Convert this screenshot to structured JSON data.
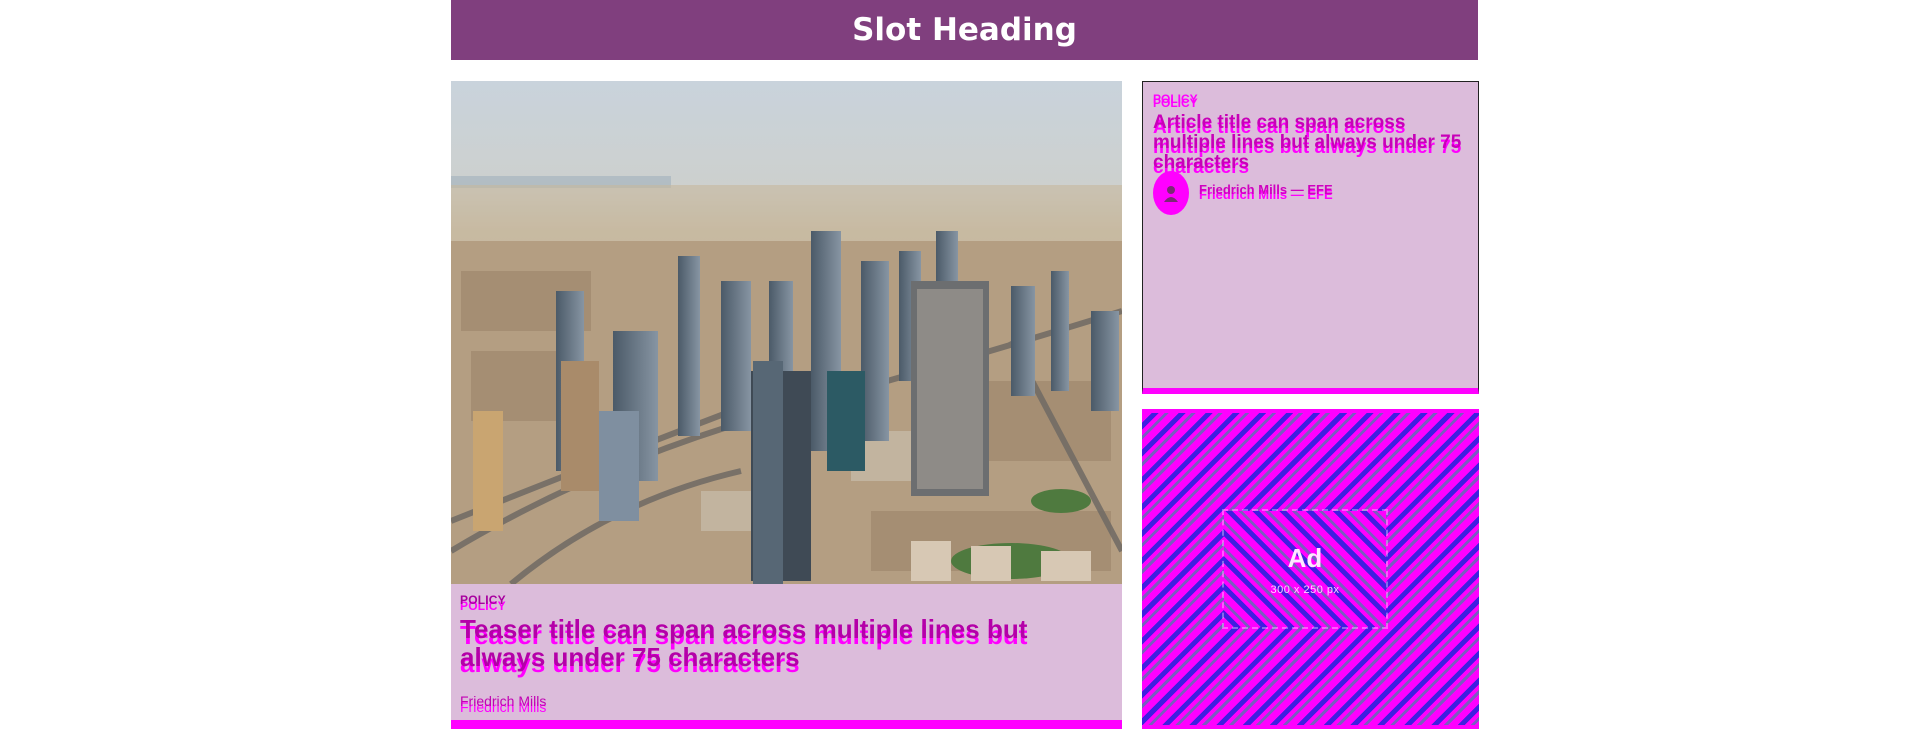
{
  "slot": {
    "heading": "Slot Heading"
  },
  "teaser": {
    "category": "POLICY",
    "title": "Teaser title can span across multiple lines but always under 75 characters",
    "author": "Friedrich Mills"
  },
  "article": {
    "category": "POLICY",
    "title": "Article title can span across multiple lines but always under 75 characters",
    "byline": "Friedrich Mills — EFE"
  },
  "ad": {
    "label": "Ad",
    "size_text": "300 x 250 px"
  },
  "colors": {
    "header_bg": "#803f7e",
    "card_bg": "#dcbcdb",
    "accent": "#ff00ff",
    "ad_stripe": "#3f1fe0"
  }
}
